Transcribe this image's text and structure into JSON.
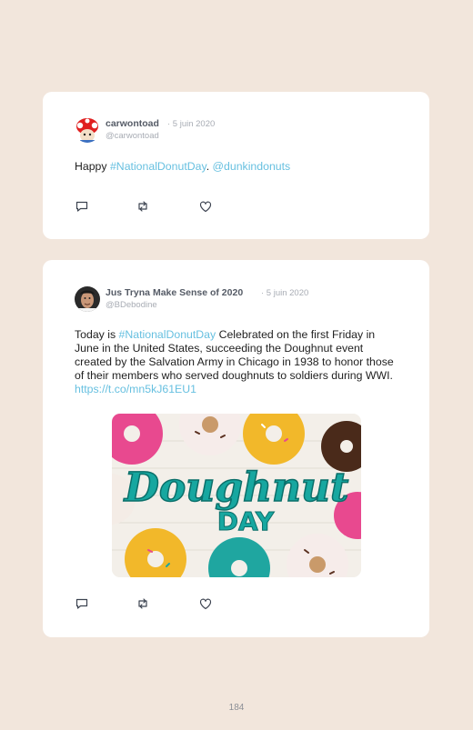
{
  "tweets": [
    {
      "name": "carwontoad",
      "date": "· 5 juin 2020",
      "handle": "@carwontoad",
      "text_before": "Happy ",
      "hashtag": "#NationalDonutDay",
      "text_middle": ". ",
      "mention": "@dunkindonuts",
      "avatar_icon": "toad-avatar"
    },
    {
      "name": "Jus Tryna Make Sense of 2020",
      "date": "· 5 juin 2020",
      "handle": "@BDebodine",
      "text_before": "Today is ",
      "hashtag": "#NationalDonutDay",
      "text_after": " Celebrated on the first Friday in June in the United States, succeeding the Doughnut event created by the Salvation Army in Chicago in 1938 to honor those of their members who served doughnuts to soldiers during WWI. ",
      "link": "https://t.co/mn5kJ61EU1",
      "avatar_icon": "person-avatar",
      "media": {
        "title_line1": "Doughnut",
        "title_line2": "DAY"
      }
    }
  ],
  "actions": {
    "reply_icon": "reply-icon",
    "retweet_icon": "retweet-icon",
    "like_icon": "heart-icon"
  },
  "page_number": "184",
  "colors": {
    "background": "#f2e6dc",
    "link": "#67c0e0",
    "title_teal": "#17a7a0"
  }
}
